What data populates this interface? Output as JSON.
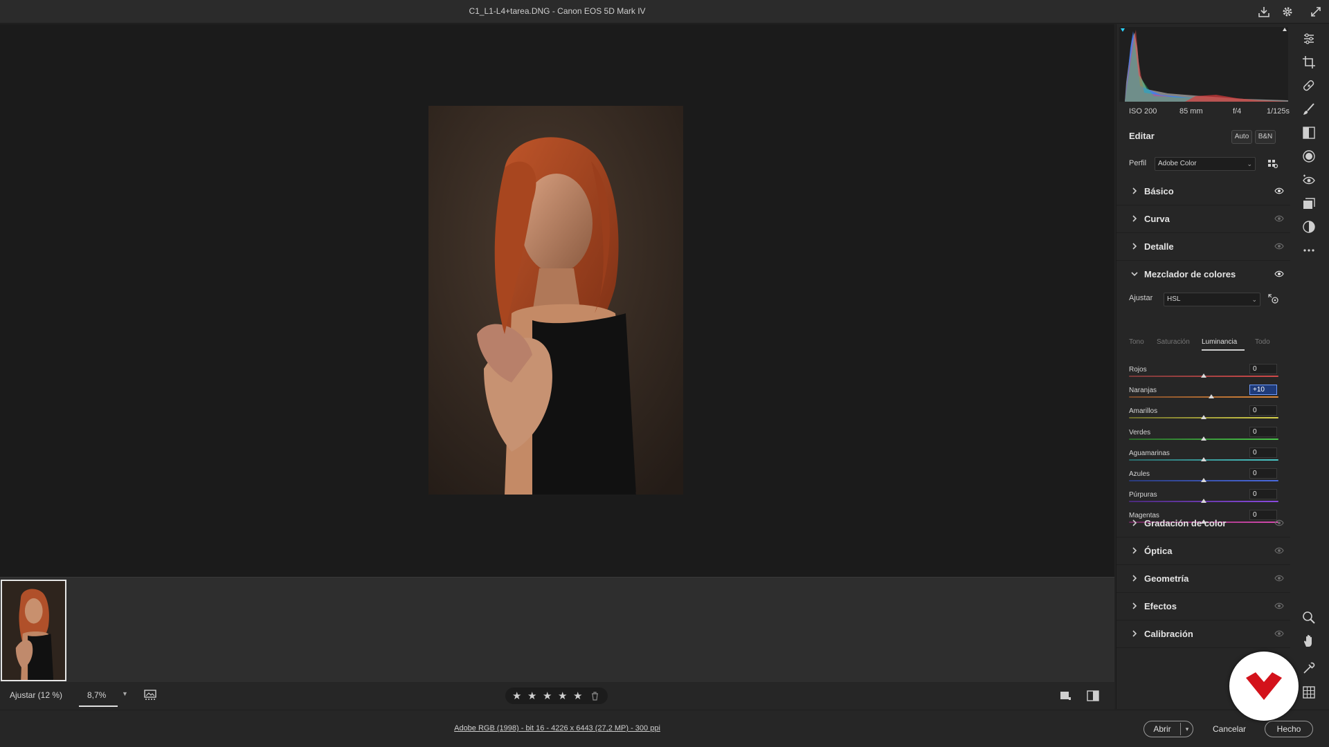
{
  "window": {
    "title": "C1_L1-L4+tarea.DNG -  Canon EOS 5D Mark IV"
  },
  "histogram": {
    "exif": {
      "iso": "ISO 200",
      "focal": "85 mm",
      "aperture": "f/4",
      "shutter": "1/125s"
    }
  },
  "edit": {
    "title": "Editar",
    "auto_label": "Auto",
    "bw_label": "B&N",
    "profile_label": "Perfil",
    "profile_value": "Adobe Color"
  },
  "sections_top": [
    {
      "label": "Básico",
      "eye_visible": true
    },
    {
      "label": "Curva",
      "eye_visible": false
    },
    {
      "label": "Detalle",
      "eye_visible": false
    }
  ],
  "mixer": {
    "title": "Mezclador de colores",
    "adjust_label": "Ajustar",
    "adjust_value": "HSL",
    "tabs": [
      "Tono",
      "Saturación",
      "Luminancia",
      "Todo"
    ],
    "active_tab": "Luminancia",
    "sliders": [
      {
        "label": "Rojos",
        "value": "0",
        "num": 0,
        "colors": [
          "#7a3a3a",
          "#d24a4a"
        ]
      },
      {
        "label": "Naranjas",
        "value": "+10",
        "num": 10,
        "colors": [
          "#7a4a2a",
          "#e08a3a"
        ],
        "active": true
      },
      {
        "label": "Amarillos",
        "value": "0",
        "num": 0,
        "colors": [
          "#6a6a2a",
          "#d8d24a"
        ]
      },
      {
        "label": "Verdes",
        "value": "0",
        "num": 0,
        "colors": [
          "#2a6a2a",
          "#4ac84a"
        ]
      },
      {
        "label": "Aguamarinas",
        "value": "0",
        "num": 0,
        "colors": [
          "#2a6a6a",
          "#4ac8c8"
        ]
      },
      {
        "label": "Azules",
        "value": "0",
        "num": 0,
        "colors": [
          "#2a3a7a",
          "#4a6ae0"
        ]
      },
      {
        "label": "Púrpuras",
        "value": "0",
        "num": 0,
        "colors": [
          "#4a2a7a",
          "#8a4ae0"
        ]
      },
      {
        "label": "Magentas",
        "value": "0",
        "num": 0,
        "colors": [
          "#6a2a5a",
          "#d84ab0"
        ]
      }
    ]
  },
  "sections_bottom": [
    {
      "label": "Gradación de color"
    },
    {
      "label": "Óptica"
    },
    {
      "label": "Geometría"
    },
    {
      "label": "Efectos"
    },
    {
      "label": "Calibración"
    }
  ],
  "status": {
    "fit_label": "Ajustar (12 %)",
    "zoom_value": "8,7%",
    "stars": 5
  },
  "bottom": {
    "file_info": "Adobe RGB (1998) - bit 16 - 4226 x 6443 (27,2 MP) - 300 ppi",
    "open_label": "Abrir",
    "cancel_label": "Cancelar",
    "done_label": "Hecho"
  },
  "colors": {
    "accent": "#6e9cff",
    "logo_red": "#d3121b"
  }
}
